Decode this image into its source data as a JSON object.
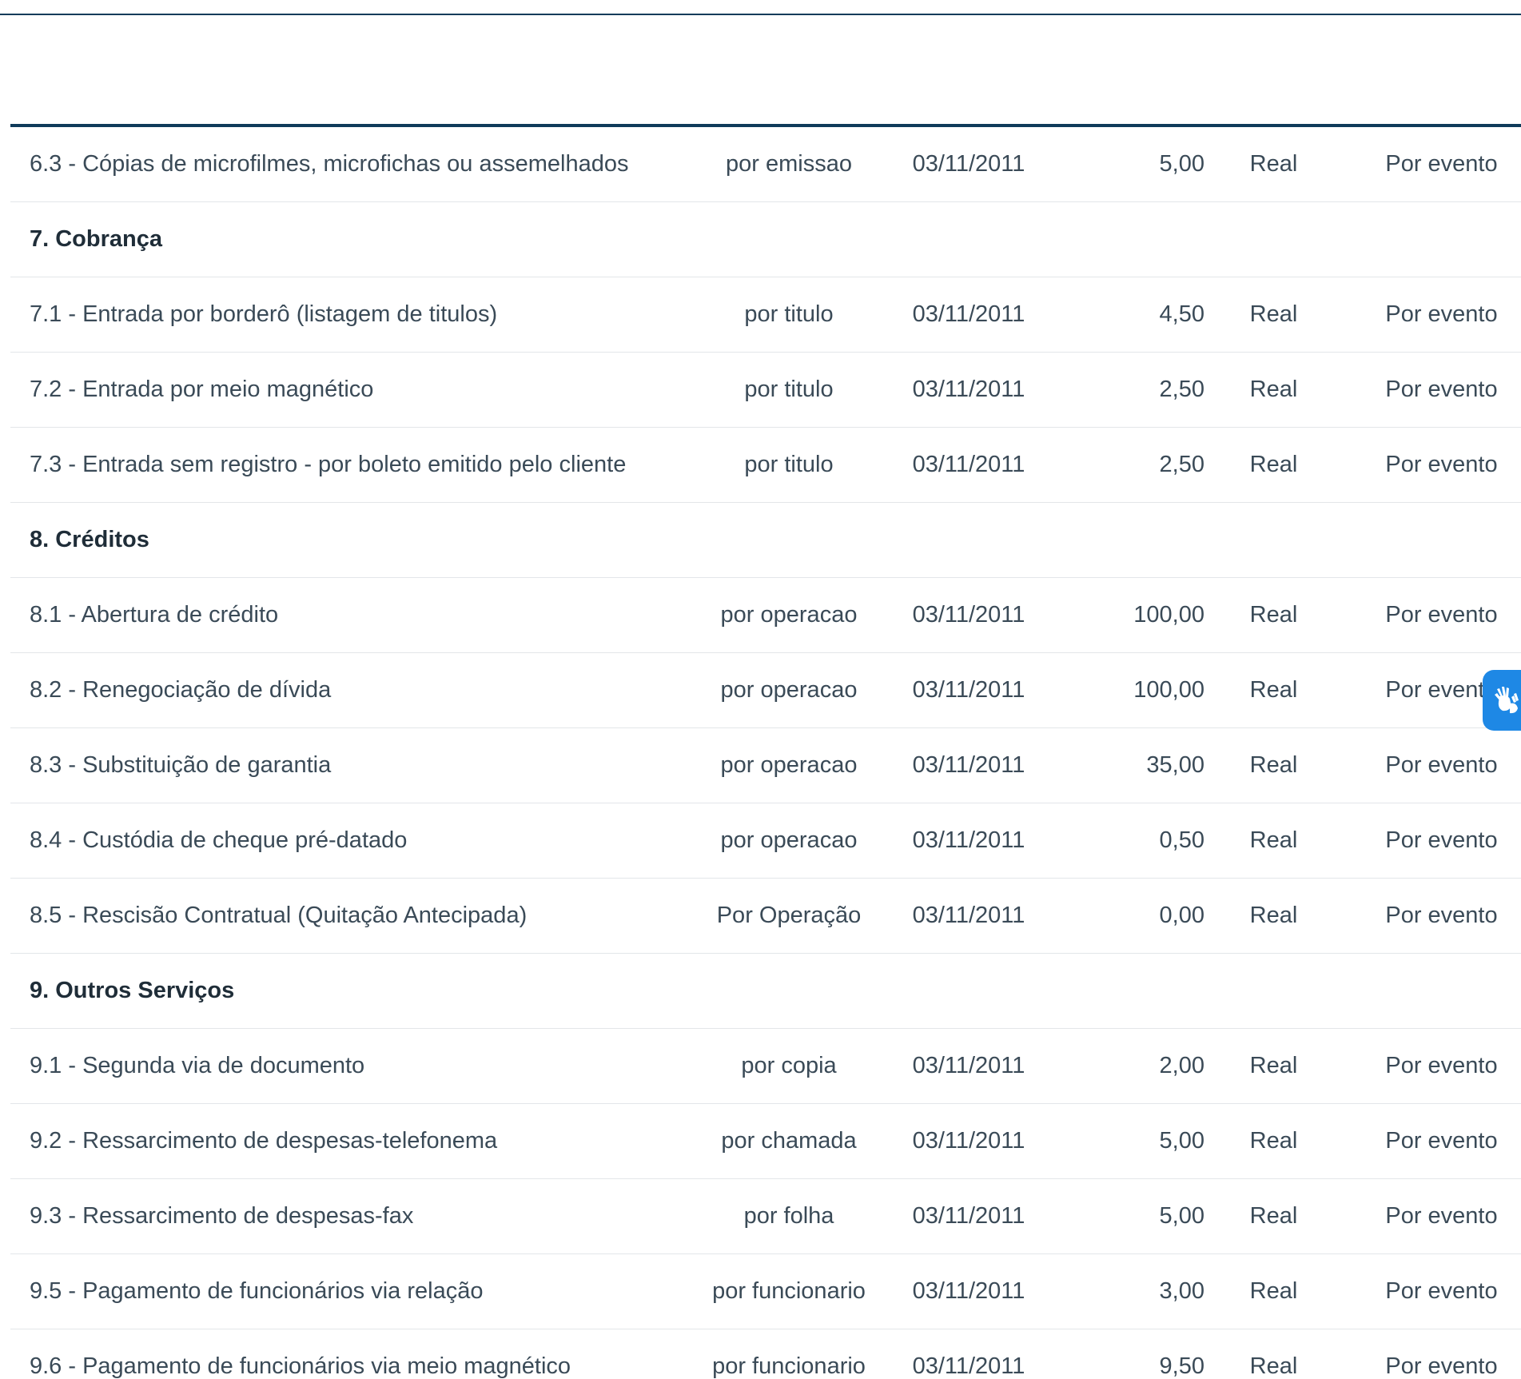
{
  "colors": {
    "rule": "#0f3b5a",
    "text": "#3a4a57",
    "divider": "#e3e6e9",
    "widget": "#1e88e5"
  },
  "table": {
    "rows": [
      {
        "type": "item",
        "desc": "6.3 - Cópias de microfilmes, microfichas ou assemelhados",
        "unit": "por emissao",
        "date": "03/11/2011",
        "value": "5,00",
        "currency": "Real",
        "frequency": "Por evento"
      },
      {
        "type": "group",
        "label": "7. Cobrança"
      },
      {
        "type": "item",
        "desc": "7.1 - Entrada por borderô (listagem de titulos)",
        "unit": "por titulo",
        "date": "03/11/2011",
        "value": "4,50",
        "currency": "Real",
        "frequency": "Por evento"
      },
      {
        "type": "item",
        "desc": "7.2 - Entrada por meio magnético",
        "unit": "por titulo",
        "date": "03/11/2011",
        "value": "2,50",
        "currency": "Real",
        "frequency": "Por evento"
      },
      {
        "type": "item",
        "desc": "7.3 - Entrada sem registro - por boleto emitido pelo cliente",
        "unit": "por titulo",
        "date": "03/11/2011",
        "value": "2,50",
        "currency": "Real",
        "frequency": "Por evento"
      },
      {
        "type": "group",
        "label": "8. Créditos"
      },
      {
        "type": "item",
        "desc": "8.1 - Abertura de crédito",
        "unit": "por operacao",
        "date": "03/11/2011",
        "value": "100,00",
        "currency": "Real",
        "frequency": "Por evento"
      },
      {
        "type": "item",
        "desc": "8.2 - Renegociação de dívida",
        "unit": "por operacao",
        "date": "03/11/2011",
        "value": "100,00",
        "currency": "Real",
        "frequency": "Por evento"
      },
      {
        "type": "item",
        "desc": "8.3 - Substituição de garantia",
        "unit": "por operacao",
        "date": "03/11/2011",
        "value": "35,00",
        "currency": "Real",
        "frequency": "Por evento"
      },
      {
        "type": "item",
        "desc": "8.4 - Custódia de cheque pré-datado",
        "unit": "por operacao",
        "date": "03/11/2011",
        "value": "0,50",
        "currency": "Real",
        "frequency": "Por evento"
      },
      {
        "type": "item",
        "desc": "8.5 - Rescisão Contratual (Quitação Antecipada)",
        "unit": "Por Operação",
        "date": "03/11/2011",
        "value": "0,00",
        "currency": "Real",
        "frequency": "Por evento"
      },
      {
        "type": "group",
        "label": "9. Outros Serviços"
      },
      {
        "type": "item",
        "desc": "9.1 - Segunda via de documento",
        "unit": "por copia",
        "date": "03/11/2011",
        "value": "2,00",
        "currency": "Real",
        "frequency": "Por evento"
      },
      {
        "type": "item",
        "desc": "9.2 - Ressarcimento de despesas-telefonema",
        "unit": "por chamada",
        "date": "03/11/2011",
        "value": "5,00",
        "currency": "Real",
        "frequency": "Por evento"
      },
      {
        "type": "item",
        "desc": "9.3 - Ressarcimento de despesas-fax",
        "unit": "por folha",
        "date": "03/11/2011",
        "value": "5,00",
        "currency": "Real",
        "frequency": "Por evento"
      },
      {
        "type": "item",
        "desc": "9.5 - Pagamento de funcionários via relação",
        "unit": "por funcionario",
        "date": "03/11/2011",
        "value": "3,00",
        "currency": "Real",
        "frequency": "Por evento"
      },
      {
        "type": "item",
        "desc": "9.6 - Pagamento de funcionários via meio magnético",
        "unit": "por funcionario",
        "date": "03/11/2011",
        "value": "9,50",
        "currency": "Real",
        "frequency": "Por evento"
      }
    ]
  },
  "accessibility_widget": {
    "icon": "sign-language-hands-icon"
  }
}
